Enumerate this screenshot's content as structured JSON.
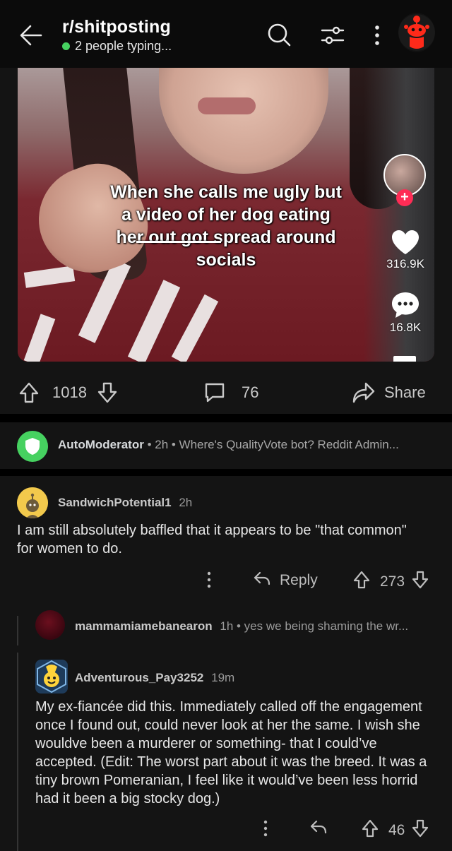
{
  "header": {
    "subreddit": "r/shitposting",
    "typing_status": "2 people typing...",
    "accent_color": "#46d160"
  },
  "video": {
    "caption": "When she calls me ugly but a video of her dog eating her out got spread around socials",
    "likes": "316.9K",
    "comments": "16.8K"
  },
  "post_actions": {
    "upvotes": "1018",
    "comment_count": "76",
    "share_label": "Share"
  },
  "automod": {
    "username": "AutoModerator",
    "meta": "• 2h • Where's QualityVote bot? Reddit Admin..."
  },
  "comments": [
    {
      "username": "SandwichPotential1",
      "time": "2h",
      "body": "I am still absolutely baffled that it appears to be \"that common\" for women to do.",
      "reply_label": "Reply",
      "votes": "273"
    },
    {
      "username": "mammamiamebanearon",
      "meta": "1h • yes we being shaming the wr..."
    },
    {
      "username": "Adventurous_Pay3252",
      "time": "19m",
      "body": "My ex-fiancée did this. Immediately called off the engagement once I found out, could never look at her the same. I wish she wouldve been a murderer or something- that I could’ve accepted. (Edit: The worst part about it was the breed. It was a tiny brown Pomeranian, I feel like it would’ve been less horrid had it been a big stocky dog.)",
      "votes": "46"
    }
  ]
}
